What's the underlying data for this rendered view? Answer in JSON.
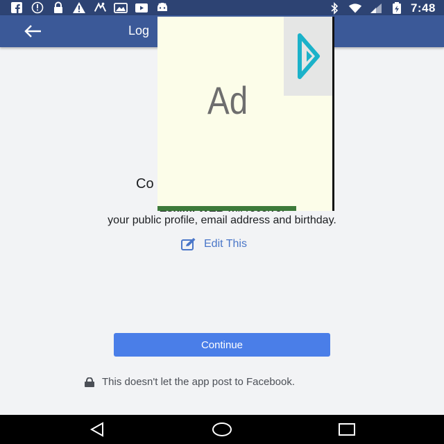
{
  "status_bar": {
    "time": "7:48",
    "left_icons": [
      "facebook-icon",
      "info-icon",
      "lock-icon",
      "warning-icon",
      "app-icon",
      "photo-icon",
      "video-icon",
      "android-icon"
    ],
    "right_icons": [
      "bluetooth-icon",
      "wifi-icon",
      "signal-icon",
      "battery-icon"
    ]
  },
  "app_bar": {
    "title": "Log"
  },
  "main": {
    "heading": "Co",
    "receive_app": "Eskimi WEB",
    "receive_suffix": " will receive:",
    "permissions": "your public profile, email address and birthday.",
    "edit_label": "Edit This",
    "continue_label": "Continue",
    "note": "This doesn't let the app post to Facebook."
  },
  "ad": {
    "label": "Ad"
  },
  "colors": {
    "app_bar": "#3b5998",
    "status_bar": "#2d4373",
    "button": "#4a7ee8",
    "link": "#4a76c8"
  }
}
